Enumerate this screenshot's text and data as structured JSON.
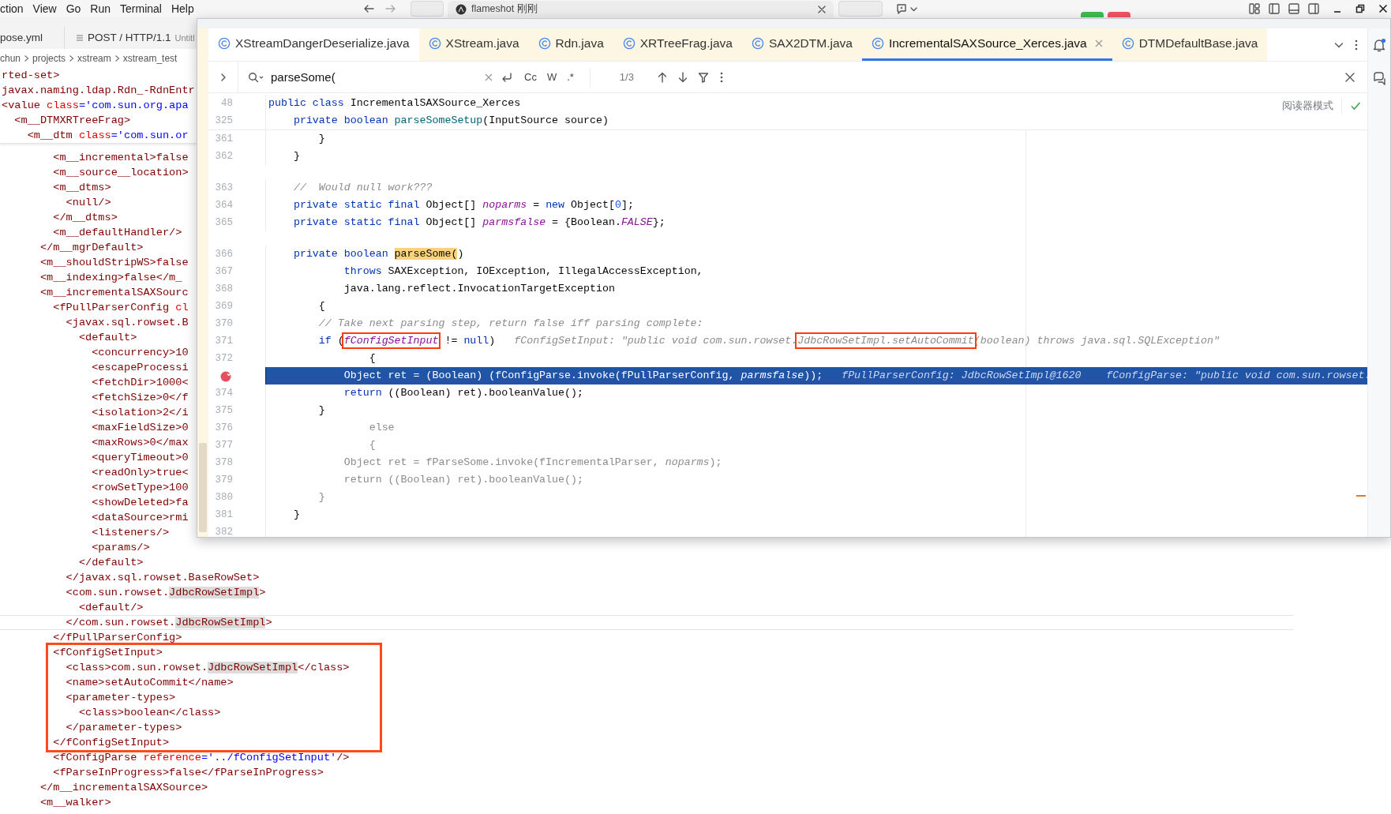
{
  "menu_bar": {
    "items": [
      "ction",
      "View",
      "Go",
      "Run",
      "Terminal",
      "Help"
    ],
    "notification": "flameshot 刚刚"
  },
  "background_editor": {
    "tabs": [
      {
        "label": "pose.yml"
      },
      {
        "label": "POST / HTTP/1.1",
        "detail": "Untitl"
      }
    ],
    "breadcrumbs": [
      "chun",
      "projects",
      "xstream",
      "xstream_test"
    ],
    "sticky_lines": [
      {
        "segments": [
          {
            "text": "rted-set>",
            "kind": "tag"
          }
        ]
      },
      {
        "segments": [
          {
            "text": "javax.naming.ldap.Rdn_-RdnEntr",
            "kind": "tag"
          }
        ]
      },
      {
        "segments": [
          {
            "text": "<value ",
            "kind": "tag"
          },
          {
            "text": "class",
            "kind": "attr"
          },
          {
            "text": "='com.sun.org.apa",
            "kind": "value"
          }
        ]
      },
      {
        "segments": [
          {
            "text": "  <m__DTMXRTreeFrag>",
            "kind": "tag"
          }
        ]
      },
      {
        "segments": [
          {
            "text": "    <m__dtm ",
            "kind": "tag"
          },
          {
            "text": "class",
            "kind": "attr"
          },
          {
            "text": "='com.sun.or",
            "kind": "value"
          }
        ]
      }
    ],
    "lines": [
      {
        "segments": [
          {
            "text": "        <m__incremental>false",
            "kind": "tag"
          }
        ]
      },
      {
        "segments": [
          {
            "text": "        <m__source__location>",
            "kind": "tag"
          }
        ]
      },
      {
        "segments": [
          {
            "text": "        <m__dtms>",
            "kind": "tag"
          }
        ]
      },
      {
        "segments": [
          {
            "text": "          <null/>",
            "kind": "tag"
          }
        ]
      },
      {
        "segments": [
          {
            "text": "        </m__dtms>",
            "kind": "tag"
          }
        ]
      },
      {
        "segments": [
          {
            "text": "        <m__defaultHandler/>",
            "kind": "tag"
          }
        ]
      },
      {
        "segments": [
          {
            "text": "      </m__mgrDefault>",
            "kind": "tag"
          }
        ]
      },
      {
        "segments": [
          {
            "text": "      <m__shouldStripWS>false",
            "kind": "tag"
          }
        ]
      },
      {
        "segments": [
          {
            "text": "      <m__indexing>false</m_",
            "kind": "tag"
          }
        ]
      },
      {
        "segments": [
          {
            "text": "      <m__incrementalSAXSourc",
            "kind": "tag"
          }
        ]
      },
      {
        "segments": [
          {
            "text": "        <fPullParserConfig ",
            "kind": "tag"
          },
          {
            "text": "cl",
            "kind": "attr"
          }
        ]
      },
      {
        "segments": [
          {
            "text": "          <javax.sql.rowset.B",
            "kind": "tag"
          }
        ]
      },
      {
        "segments": [
          {
            "text": "            <default>",
            "kind": "tag"
          }
        ]
      },
      {
        "segments": [
          {
            "text": "              <concurrency>10",
            "kind": "tag"
          }
        ]
      },
      {
        "segments": [
          {
            "text": "              <escapeProcessi",
            "kind": "tag"
          }
        ]
      },
      {
        "segments": [
          {
            "text": "              <fetchDir>1000<",
            "kind": "tag"
          }
        ]
      },
      {
        "segments": [
          {
            "text": "              <fetchSize>0</f",
            "kind": "tag"
          }
        ]
      },
      {
        "segments": [
          {
            "text": "              <isolation>2</i",
            "kind": "tag"
          }
        ]
      },
      {
        "segments": [
          {
            "text": "              <maxFieldSize>0",
            "kind": "tag"
          }
        ]
      },
      {
        "segments": [
          {
            "text": "              <maxRows>0</max",
            "kind": "tag"
          }
        ]
      },
      {
        "segments": [
          {
            "text": "              <queryTimeout>0",
            "kind": "tag"
          }
        ]
      },
      {
        "segments": [
          {
            "text": "              <readOnly>true<",
            "kind": "tag"
          }
        ]
      },
      {
        "segments": [
          {
            "text": "              <rowSetType>100",
            "kind": "tag"
          }
        ]
      },
      {
        "segments": [
          {
            "text": "              <showDeleted>fa",
            "kind": "tag"
          }
        ]
      },
      {
        "segments": [
          {
            "text": "              <dataSource>rmi",
            "kind": "tag"
          }
        ]
      },
      {
        "segments": [
          {
            "text": "              <listeners/>",
            "kind": "tag"
          }
        ]
      },
      {
        "segments": [
          {
            "text": "              <params/>",
            "kind": "tag"
          }
        ]
      },
      {
        "segments": [
          {
            "text": "            </default>",
            "kind": "tag"
          }
        ]
      },
      {
        "segments": [
          {
            "text": "          </javax.sql.rowset.BaseRowSet>",
            "kind": "tag"
          }
        ]
      },
      {
        "segments": [
          {
            "text": "          <com.sun.rowset.",
            "kind": "tag"
          },
          {
            "text": "JdbcRowSetImpl",
            "kind": "match"
          },
          {
            "text": ">",
            "kind": "tag"
          }
        ]
      },
      {
        "segments": [
          {
            "text": "            <default/>",
            "kind": "tag"
          }
        ]
      },
      {
        "current": true,
        "segments": [
          {
            "text": "          </com.sun.rowset.",
            "kind": "tag"
          },
          {
            "text": "JdbcRowSetImpl",
            "kind": "match"
          },
          {
            "text": ">",
            "kind": "tag"
          }
        ]
      },
      {
        "segments": [
          {
            "text": "        </fPullParserConfig>",
            "kind": "tag"
          }
        ]
      },
      {
        "boxed": true,
        "segments": [
          {
            "text": "        <fConfigSetInput>",
            "kind": "tag"
          }
        ]
      },
      {
        "boxed": true,
        "segments": [
          {
            "text": "          <class>com.sun.rowset.",
            "kind": "tag"
          },
          {
            "text": "JdbcRowSetImpl",
            "kind": "match"
          },
          {
            "text": "</class>",
            "kind": "tag"
          }
        ]
      },
      {
        "boxed": true,
        "segments": [
          {
            "text": "          <name>setAutoCommit</name>",
            "kind": "tag"
          }
        ]
      },
      {
        "boxed": true,
        "segments": [
          {
            "text": "          <parameter-types>",
            "kind": "tag"
          }
        ]
      },
      {
        "boxed": true,
        "segments": [
          {
            "text": "            <class>boolean</class>",
            "kind": "tag"
          }
        ]
      },
      {
        "boxed": true,
        "segments": [
          {
            "text": "          </parameter-types>",
            "kind": "tag"
          }
        ]
      },
      {
        "boxed": true,
        "segments": [
          {
            "text": "        </fConfigSetInput>",
            "kind": "tag"
          }
        ]
      },
      {
        "segments": [
          {
            "text": "        <fConfigParse ",
            "kind": "tag"
          },
          {
            "text": "reference",
            "kind": "attr"
          },
          {
            "text": "='../fConfigSetInput'",
            "kind": "value"
          },
          {
            "text": "/>",
            "kind": "tag"
          }
        ]
      },
      {
        "segments": [
          {
            "text": "        <fParseInProgress>false</fParseInProgress>",
            "kind": "tag"
          }
        ]
      },
      {
        "segments": [
          {
            "text": "      </m__incrementalSAXSource>",
            "kind": "tag"
          }
        ]
      },
      {
        "segments": [
          {
            "text": "      <m__walker>",
            "kind": "tag"
          }
        ]
      }
    ]
  },
  "popup": {
    "tabs": [
      {
        "label": "XStreamDangerDeserialize.java",
        "selected": false,
        "tinted": false
      },
      {
        "label": "XStream.java",
        "selected": false,
        "tinted": true
      },
      {
        "label": "Rdn.java",
        "selected": false,
        "tinted": true
      },
      {
        "label": "XRTreeFrag.java",
        "selected": false,
        "tinted": true
      },
      {
        "label": "SAX2DTM.java",
        "selected": false,
        "tinted": true
      },
      {
        "label": "IncrementalSAXSource_Xerces.java",
        "selected": true,
        "tinted": true
      },
      {
        "label": "DTMDefaultBase.java",
        "selected": false,
        "tinted": true
      }
    ],
    "search": {
      "value": "parseSome(",
      "toggles": [
        "Cc",
        "W",
        ".*"
      ],
      "match_count": "1/3"
    },
    "reader_mode": "阅读器模式",
    "sticky_lines": [
      {
        "number": "48",
        "segments": [
          {
            "text": "public class",
            "kind": "kw"
          },
          {
            "text": " IncrementalSAXSource_Xerces",
            "kind": "plain"
          }
        ]
      },
      {
        "number": "325",
        "segments": [
          {
            "text": "    private boolean ",
            "kind": "kw"
          },
          {
            "text": "parseSomeSetup",
            "kind": "method"
          },
          {
            "text": "(InputSource source)",
            "kind": "plain"
          }
        ]
      }
    ],
    "lines": [
      {
        "number": "361",
        "segments": [
          {
            "text": "        }",
            "kind": "plain"
          }
        ]
      },
      {
        "number": "362",
        "segments": [
          {
            "text": "    }",
            "kind": "plain"
          }
        ]
      },
      {
        "number": "363",
        "gap_above": true,
        "segments": [
          {
            "text": "    //  Would null work???",
            "kind": "comment"
          }
        ]
      },
      {
        "number": "364",
        "segments": [
          {
            "text": "    private static final",
            "kind": "kw"
          },
          {
            "text": " Object[] ",
            "kind": "plain"
          },
          {
            "text": "noparms",
            "kind": "field"
          },
          {
            "text": " = ",
            "kind": "plain"
          },
          {
            "text": "new",
            "kind": "kw"
          },
          {
            "text": " Object[",
            "kind": "plain"
          },
          {
            "text": "0",
            "kind": "number"
          },
          {
            "text": "];",
            "kind": "plain"
          }
        ]
      },
      {
        "number": "365",
        "segments": [
          {
            "text": "    private static final",
            "kind": "kw"
          },
          {
            "text": " Object[] ",
            "kind": "plain"
          },
          {
            "text": "parmsfalse",
            "kind": "field"
          },
          {
            "text": " = {Boolean.",
            "kind": "plain"
          },
          {
            "text": "FALSE",
            "kind": "field"
          },
          {
            "text": "};",
            "kind": "plain"
          }
        ]
      },
      {
        "number": "366",
        "gap_above": true,
        "segments": [
          {
            "text": "    private boolean ",
            "kind": "kw"
          },
          {
            "text": "parseSome(",
            "kind": "match"
          },
          {
            "text": ")",
            "kind": "plain"
          }
        ]
      },
      {
        "number": "367",
        "segments": [
          {
            "text": "            throws",
            "kind": "kw"
          },
          {
            "text": " SAXException, IOException, IllegalAccessException,",
            "kind": "plain"
          }
        ]
      },
      {
        "number": "368",
        "segments": [
          {
            "text": "            java.lang.reflect.InvocationTargetException",
            "kind": "plain"
          }
        ]
      },
      {
        "number": "369",
        "segments": [
          {
            "text": "        {",
            "kind": "plain"
          }
        ]
      },
      {
        "number": "370",
        "segments": [
          {
            "text": "        // Take next parsing step, return false iff parsing complete:",
            "kind": "comment"
          }
        ]
      },
      {
        "number": "371",
        "segments": [
          {
            "text": "        if",
            "kind": "kw"
          },
          {
            "text": " (",
            "kind": "plain"
          },
          {
            "text": "fConfigSetInput",
            "kind": "field",
            "boxed": true
          },
          {
            "text": " != ",
            "kind": "plain"
          },
          {
            "text": "null",
            "kind": "kw"
          },
          {
            "text": ")",
            "kind": "plain"
          },
          {
            "text": "   fConfigSetInput: \"public void com.sun.rowset.",
            "kind": "hint"
          },
          {
            "text": "JdbcRowSetImpl.setAutoCommit",
            "kind": "hint",
            "boxed": true
          },
          {
            "text": "(boolean) throws java.sql.SQLException\"",
            "kind": "hint"
          }
        ]
      },
      {
        "number": "372",
        "segments": [
          {
            "text": "                {",
            "kind": "plain"
          }
        ]
      },
      {
        "current": true,
        "breakpoint": true,
        "segments": [
          {
            "text": "            Object ret = (Boolean) (fConfigParse.invoke(fPullParserConfig, ",
            "kind": "plain"
          },
          {
            "text": "parmsfalse",
            "kind": "field"
          },
          {
            "text": "));",
            "kind": "plain"
          },
          {
            "text": "   fPullParserConfig: JdbcRowSetImpl@1620",
            "kind": "hint"
          },
          {
            "text": "    fConfigParse: \"public void com.sun.rowset.",
            "kind": "hint"
          }
        ]
      },
      {
        "number": "374",
        "segments": [
          {
            "text": "            return",
            "kind": "kw"
          },
          {
            "text": " ((Boolean) ret).booleanValue();",
            "kind": "plain"
          }
        ]
      },
      {
        "number": "375",
        "segments": [
          {
            "text": "        }",
            "kind": "plain"
          }
        ]
      },
      {
        "number": "376",
        "segments": [
          {
            "text": "                else",
            "kind": "inactive"
          }
        ]
      },
      {
        "number": "377",
        "segments": [
          {
            "text": "                {",
            "kind": "inactive"
          }
        ]
      },
      {
        "number": "378",
        "segments": [
          {
            "text": "            Object ret = fParseSome.invoke(fIncrementalParser, ",
            "kind": "inactive"
          },
          {
            "text": "noparms",
            "kind": "inactive_field"
          },
          {
            "text": ");",
            "kind": "inactive"
          }
        ]
      },
      {
        "number": "379",
        "segments": [
          {
            "text": "            return ((Boolean) ret).booleanValue();",
            "kind": "inactive"
          }
        ]
      },
      {
        "number": "380",
        "segments": [
          {
            "text": "        }",
            "kind": "inactive"
          }
        ]
      },
      {
        "number": "381",
        "segments": [
          {
            "text": "    }",
            "kind": "plain"
          }
        ]
      },
      {
        "number": "382"
      }
    ]
  }
}
